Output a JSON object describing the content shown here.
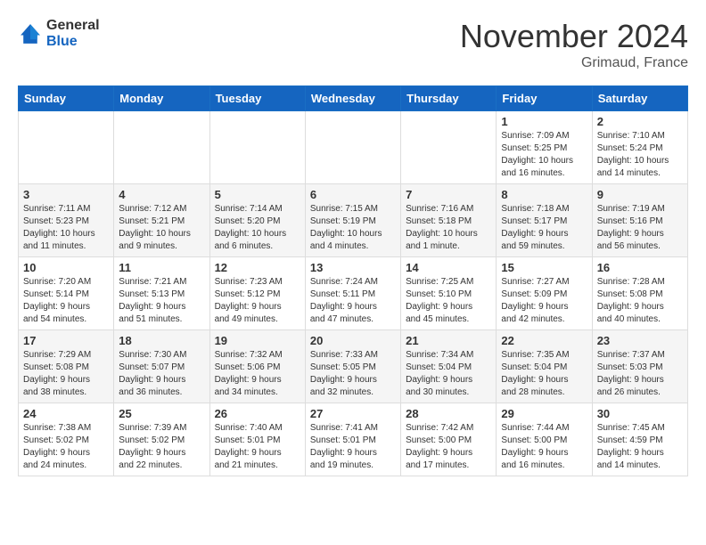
{
  "header": {
    "logo_general": "General",
    "logo_blue": "Blue",
    "month_title": "November 2024",
    "location": "Grimaud, France"
  },
  "weekdays": [
    "Sunday",
    "Monday",
    "Tuesday",
    "Wednesday",
    "Thursday",
    "Friday",
    "Saturday"
  ],
  "weeks": [
    [
      {
        "day": "",
        "info": ""
      },
      {
        "day": "",
        "info": ""
      },
      {
        "day": "",
        "info": ""
      },
      {
        "day": "",
        "info": ""
      },
      {
        "day": "",
        "info": ""
      },
      {
        "day": "1",
        "info": "Sunrise: 7:09 AM\nSunset: 5:25 PM\nDaylight: 10 hours\nand 16 minutes."
      },
      {
        "day": "2",
        "info": "Sunrise: 7:10 AM\nSunset: 5:24 PM\nDaylight: 10 hours\nand 14 minutes."
      }
    ],
    [
      {
        "day": "3",
        "info": "Sunrise: 7:11 AM\nSunset: 5:23 PM\nDaylight: 10 hours\nand 11 minutes."
      },
      {
        "day": "4",
        "info": "Sunrise: 7:12 AM\nSunset: 5:21 PM\nDaylight: 10 hours\nand 9 minutes."
      },
      {
        "day": "5",
        "info": "Sunrise: 7:14 AM\nSunset: 5:20 PM\nDaylight: 10 hours\nand 6 minutes."
      },
      {
        "day": "6",
        "info": "Sunrise: 7:15 AM\nSunset: 5:19 PM\nDaylight: 10 hours\nand 4 minutes."
      },
      {
        "day": "7",
        "info": "Sunrise: 7:16 AM\nSunset: 5:18 PM\nDaylight: 10 hours\nand 1 minute."
      },
      {
        "day": "8",
        "info": "Sunrise: 7:18 AM\nSunset: 5:17 PM\nDaylight: 9 hours\nand 59 minutes."
      },
      {
        "day": "9",
        "info": "Sunrise: 7:19 AM\nSunset: 5:16 PM\nDaylight: 9 hours\nand 56 minutes."
      }
    ],
    [
      {
        "day": "10",
        "info": "Sunrise: 7:20 AM\nSunset: 5:14 PM\nDaylight: 9 hours\nand 54 minutes."
      },
      {
        "day": "11",
        "info": "Sunrise: 7:21 AM\nSunset: 5:13 PM\nDaylight: 9 hours\nand 51 minutes."
      },
      {
        "day": "12",
        "info": "Sunrise: 7:23 AM\nSunset: 5:12 PM\nDaylight: 9 hours\nand 49 minutes."
      },
      {
        "day": "13",
        "info": "Sunrise: 7:24 AM\nSunset: 5:11 PM\nDaylight: 9 hours\nand 47 minutes."
      },
      {
        "day": "14",
        "info": "Sunrise: 7:25 AM\nSunset: 5:10 PM\nDaylight: 9 hours\nand 45 minutes."
      },
      {
        "day": "15",
        "info": "Sunrise: 7:27 AM\nSunset: 5:09 PM\nDaylight: 9 hours\nand 42 minutes."
      },
      {
        "day": "16",
        "info": "Sunrise: 7:28 AM\nSunset: 5:08 PM\nDaylight: 9 hours\nand 40 minutes."
      }
    ],
    [
      {
        "day": "17",
        "info": "Sunrise: 7:29 AM\nSunset: 5:08 PM\nDaylight: 9 hours\nand 38 minutes."
      },
      {
        "day": "18",
        "info": "Sunrise: 7:30 AM\nSunset: 5:07 PM\nDaylight: 9 hours\nand 36 minutes."
      },
      {
        "day": "19",
        "info": "Sunrise: 7:32 AM\nSunset: 5:06 PM\nDaylight: 9 hours\nand 34 minutes."
      },
      {
        "day": "20",
        "info": "Sunrise: 7:33 AM\nSunset: 5:05 PM\nDaylight: 9 hours\nand 32 minutes."
      },
      {
        "day": "21",
        "info": "Sunrise: 7:34 AM\nSunset: 5:04 PM\nDaylight: 9 hours\nand 30 minutes."
      },
      {
        "day": "22",
        "info": "Sunrise: 7:35 AM\nSunset: 5:04 PM\nDaylight: 9 hours\nand 28 minutes."
      },
      {
        "day": "23",
        "info": "Sunrise: 7:37 AM\nSunset: 5:03 PM\nDaylight: 9 hours\nand 26 minutes."
      }
    ],
    [
      {
        "day": "24",
        "info": "Sunrise: 7:38 AM\nSunset: 5:02 PM\nDaylight: 9 hours\nand 24 minutes."
      },
      {
        "day": "25",
        "info": "Sunrise: 7:39 AM\nSunset: 5:02 PM\nDaylight: 9 hours\nand 22 minutes."
      },
      {
        "day": "26",
        "info": "Sunrise: 7:40 AM\nSunset: 5:01 PM\nDaylight: 9 hours\nand 21 minutes."
      },
      {
        "day": "27",
        "info": "Sunrise: 7:41 AM\nSunset: 5:01 PM\nDaylight: 9 hours\nand 19 minutes."
      },
      {
        "day": "28",
        "info": "Sunrise: 7:42 AM\nSunset: 5:00 PM\nDaylight: 9 hours\nand 17 minutes."
      },
      {
        "day": "29",
        "info": "Sunrise: 7:44 AM\nSunset: 5:00 PM\nDaylight: 9 hours\nand 16 minutes."
      },
      {
        "day": "30",
        "info": "Sunrise: 7:45 AM\nSunset: 4:59 PM\nDaylight: 9 hours\nand 14 minutes."
      }
    ]
  ]
}
